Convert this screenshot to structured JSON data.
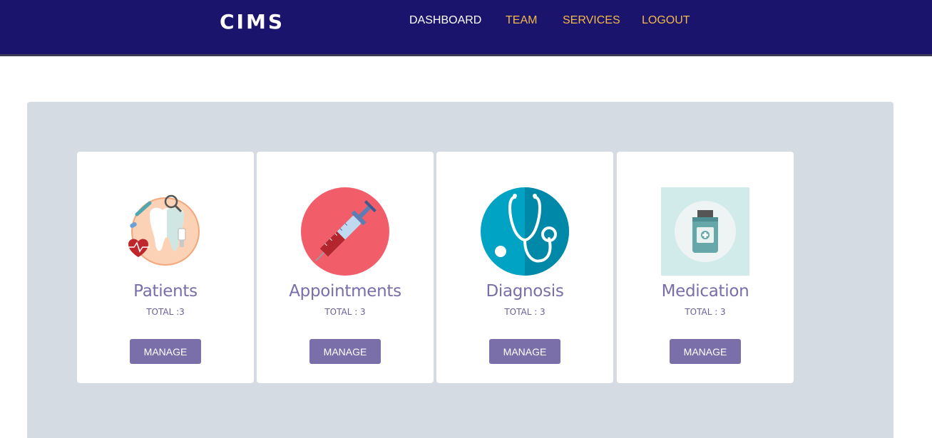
{
  "brand": "CIMS",
  "nav": {
    "dashboard": "DASHBOARD",
    "team": "TEAM",
    "services": "SERVICES",
    "logout": "LOGOUT"
  },
  "cards": [
    {
      "title": "Patients",
      "total": "TOTAL :3",
      "button": "MANAGE",
      "icon": "tooth-medical-icon"
    },
    {
      "title": "Appointments",
      "total": "TOTAL : 3",
      "button": "MANAGE",
      "icon": "syringe-icon"
    },
    {
      "title": "Diagnosis",
      "total": "TOTAL : 3",
      "button": "MANAGE",
      "icon": "stethoscope-icon"
    },
    {
      "title": "Medication",
      "total": "TOTAL : 3",
      "button": "MANAGE",
      "icon": "medicine-bottle-icon"
    }
  ],
  "colors": {
    "navbar": "#1b146c",
    "nav_active": "#ffffff",
    "nav_link": "#f3b94a",
    "panel": "#d4dbe3",
    "accent": "#7b6fa9"
  }
}
